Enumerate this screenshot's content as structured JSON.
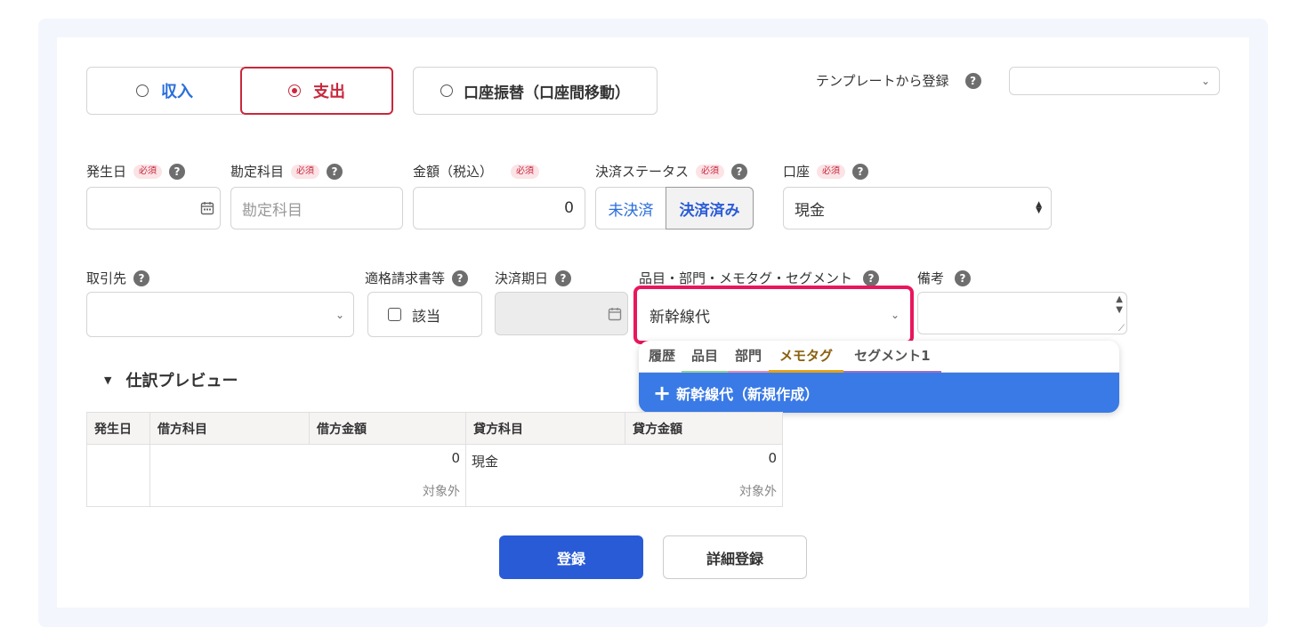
{
  "tabs": {
    "income": "収入",
    "expense": "支出",
    "transfer": "口座振替（口座間移動）"
  },
  "template": {
    "label": "テンプレートから登録"
  },
  "fields": {
    "required_badge": "必須",
    "date_label": "発生日",
    "account_label": "勘定科目",
    "account_placeholder": "勘定科目",
    "amount_label": "金額（税込）",
    "amount_value": "0",
    "status_label": "決済ステータス",
    "status_unpaid": "未決済",
    "status_paid": "決済済み",
    "wallet_label": "口座",
    "wallet_value": "現金",
    "partner_label": "取引先",
    "invoice_label": "適格請求書等",
    "invoice_checkbox": "該当",
    "due_label": "決済期日",
    "tag_label": "品目・部門・メモタグ・セグメント",
    "tag_value": "新幹線代",
    "memo_label": "備考"
  },
  "dropdown": {
    "tabs": [
      "履歴",
      "品目",
      "部門",
      "メモタグ",
      "セグメント1"
    ],
    "active_tab": "メモタグ",
    "create_option": "新幹線代（新規作成）"
  },
  "preview": {
    "title": "仕訳プレビュー",
    "columns": [
      "発生日",
      "借方科目",
      "借方金額",
      "貸方科目",
      "貸方金額"
    ],
    "row": {
      "date": "",
      "debit_account": "",
      "debit_amount": "0",
      "debit_tax": "対象外",
      "credit_account": "現金",
      "credit_amount": "0",
      "credit_tax": "対象外"
    }
  },
  "buttons": {
    "register": "登録",
    "detail_register": "詳細登録"
  },
  "colors": {
    "accent_blue": "#2a5bd7",
    "expense_red": "#c8283c",
    "highlight_pink": "#e8175d",
    "dropdown_blue": "#3a7ae6",
    "income_blue": "#2a6edb"
  }
}
